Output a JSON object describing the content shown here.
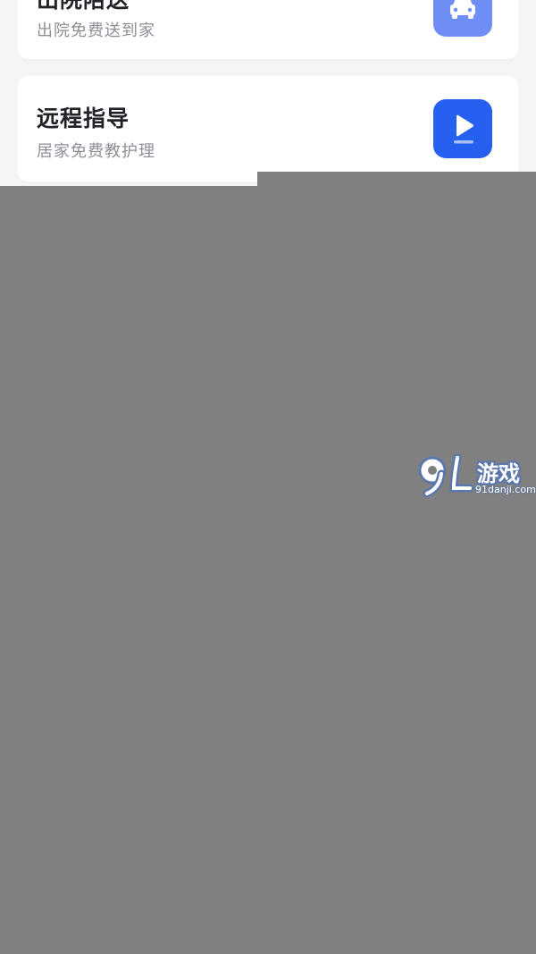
{
  "services": [
    {
      "title": "出院陪送",
      "subtitle": "出院免费送到家",
      "icon": "car-icon",
      "icon_color": "#6f8ef5"
    },
    {
      "title": "远程指导",
      "subtitle": "居家免费教护理",
      "icon": "video-play-icon",
      "icon_color": "#2560f0"
    }
  ],
  "watermark": {
    "brand": "游戏",
    "url": "91danji.com"
  },
  "colors": {
    "overlay": "#808080",
    "background": "#f4f5f7",
    "title_text": "#222328",
    "subtitle_text": "#8c8f96"
  }
}
